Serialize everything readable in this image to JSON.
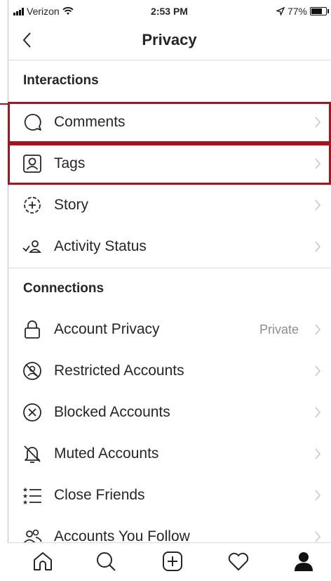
{
  "status_bar": {
    "carrier": "Verizon",
    "time": "2:53 PM",
    "battery": "77%",
    "battery_level": 0.77
  },
  "header": {
    "title": "Privacy",
    "back_icon": "chevron-left-icon"
  },
  "sections": [
    {
      "title": "Interactions",
      "items": [
        {
          "label": "Comments",
          "icon": "comment-bubble-icon",
          "highlighted": true
        },
        {
          "label": "Tags",
          "icon": "tag-person-icon",
          "highlighted": true
        },
        {
          "label": "Story",
          "icon": "story-add-icon"
        },
        {
          "label": "Activity Status",
          "icon": "activity-status-icon"
        }
      ]
    },
    {
      "title": "Connections",
      "items": [
        {
          "label": "Account Privacy",
          "icon": "lock-icon",
          "value": "Private"
        },
        {
          "label": "Restricted Accounts",
          "icon": "restricted-icon"
        },
        {
          "label": "Blocked Accounts",
          "icon": "blocked-icon"
        },
        {
          "label": "Muted Accounts",
          "icon": "muted-bell-icon"
        },
        {
          "label": "Close Friends",
          "icon": "close-friends-list-icon"
        },
        {
          "label": "Accounts You Follow",
          "icon": "accounts-follow-icon"
        }
      ]
    }
  ],
  "tab_bar": {
    "tabs": [
      "home-icon",
      "search-icon",
      "add-post-icon",
      "activity-heart-icon",
      "profile-icon"
    ],
    "active": "profile-icon"
  },
  "colors": {
    "highlight": "#b0101a",
    "text": "#262626",
    "secondary": "#8e8e8e",
    "divider": "#dbdbdb"
  }
}
